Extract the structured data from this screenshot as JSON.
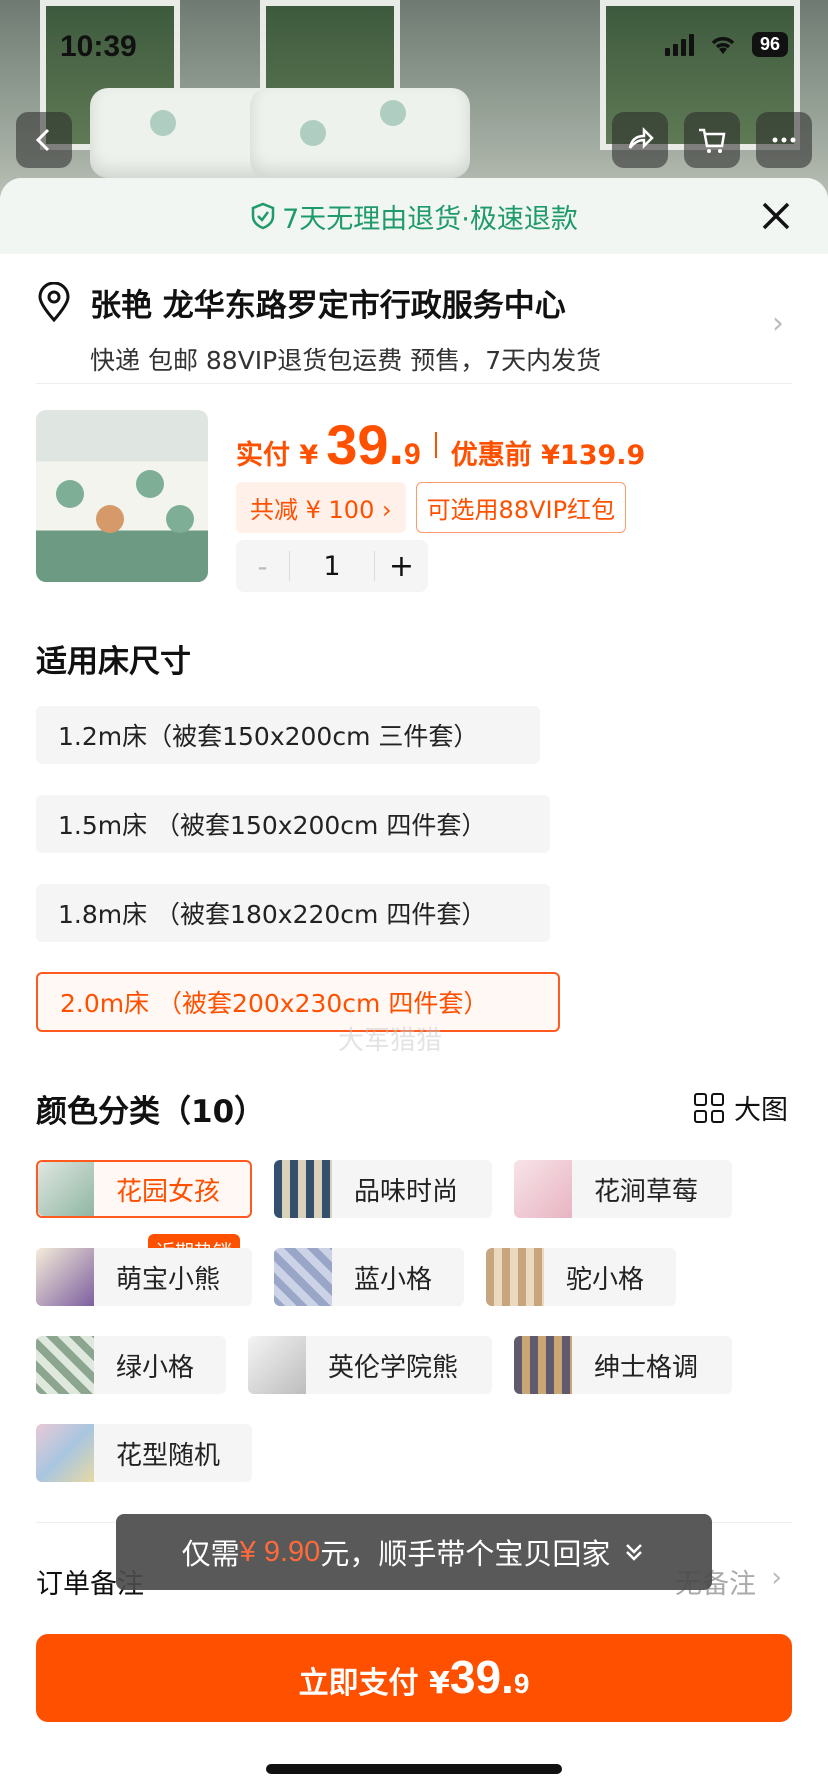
{
  "status_bar": {
    "time": "10:39",
    "battery": "96"
  },
  "return_banner": {
    "text": "7天无理由退货·极速退款"
  },
  "address": {
    "name_line": "张艳 龙华东路罗定市行政服务中心",
    "delivery_line": "快递 包邮 88VIP退货包运费 预售，7天内发货"
  },
  "product": {
    "price_label": "实付 ¥",
    "price_int": "39.",
    "price_dec": "9",
    "orig_label": "优惠前 ¥139.9",
    "discount_chip": "共减 ¥ 100 ›",
    "vip_chip": "可选用88VIP红包",
    "quantity": "1",
    "minus": "-",
    "plus": "+"
  },
  "size_section": {
    "title": "适用床尺寸",
    "options": [
      "1.2m床（被套150x200cm 三件套）",
      "1.5m床 （被套150x200cm 四件套）",
      "1.8m床 （被套180x220cm 四件套）",
      "2.0m床 （被套200x230cm 四件套）"
    ]
  },
  "watermark": "大军猎猎",
  "color_section": {
    "title": "颜色分类（10）",
    "big_view": "大图",
    "hot_badge": "近期热销",
    "options": [
      "花园女孩",
      "品味时尚",
      "花涧草莓",
      "萌宝小熊",
      "蓝小格",
      "驼小格",
      "绿小格",
      "英伦学院熊",
      "绅士格调",
      "花型随机"
    ]
  },
  "note": {
    "label": "订单备注",
    "value": "无备注"
  },
  "toast": {
    "prefix": "仅需",
    "amount": "¥ 9.90",
    "suffix": "元，顺手带个宝贝回家"
  },
  "pay_button": {
    "label": "立即支付 ¥",
    "int": "39.",
    "dec": "9"
  },
  "colors": {
    "accent": "#ff5000",
    "green": "#1f9a6a"
  }
}
